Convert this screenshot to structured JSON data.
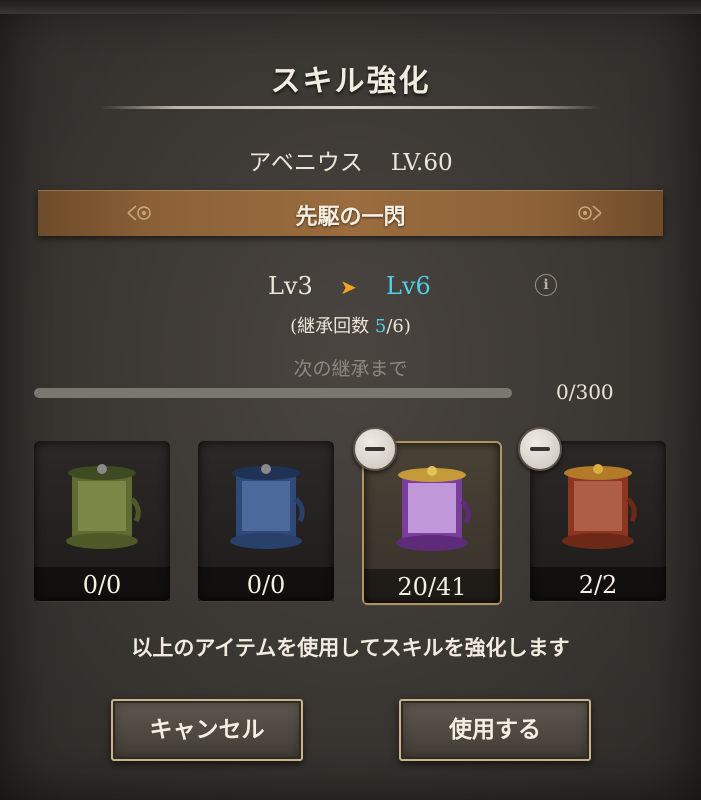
{
  "dialog": {
    "title": "スキル強化",
    "hero_name": "アベニウス",
    "hero_level": "LV.60",
    "skill_name": "先駆の一閃"
  },
  "upgrade": {
    "from_level": "Lv3",
    "to_level": "Lv6",
    "inherit_prefix": "(継承回数 ",
    "inherit_current": "5",
    "inherit_suffix": "/6)",
    "next_label": "次の継承まで",
    "progress_text": "0/300",
    "progress_fraction": 0
  },
  "items": [
    {
      "color": "green",
      "count": "0/0",
      "selected": false,
      "removable": false
    },
    {
      "color": "blue",
      "count": "0/0",
      "selected": false,
      "removable": false
    },
    {
      "color": "purple",
      "count": "20/41",
      "selected": true,
      "removable": true
    },
    {
      "color": "red",
      "count": "2/2",
      "selected": false,
      "removable": true
    }
  ],
  "description": "以上のアイテムを使用してスキルを強化します",
  "buttons": {
    "cancel": "キャンセル",
    "use": "使用する"
  },
  "colors": {
    "accent_cyan": "#4fd0e6",
    "arrow_orange": "#f2a51c",
    "banner_brown": "#9a6c3e"
  }
}
